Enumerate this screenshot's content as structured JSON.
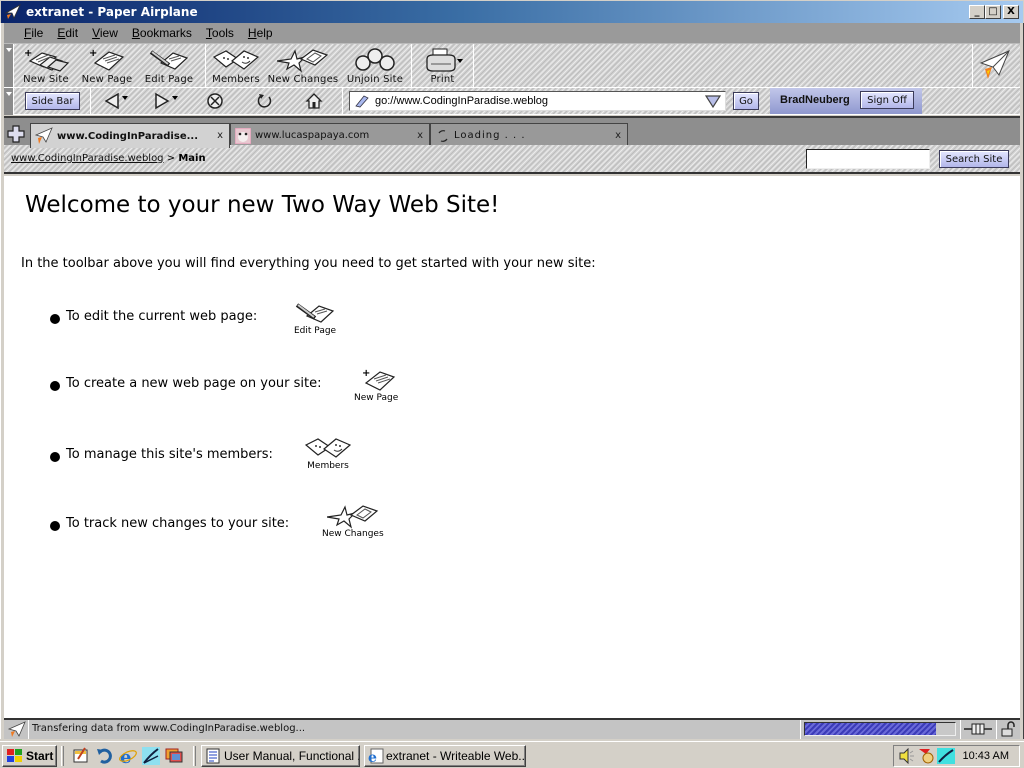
{
  "window": {
    "title": "extranet - Paper Airplane",
    "minimize": "_",
    "maximize": "□",
    "close": "X"
  },
  "menu": {
    "items": [
      {
        "label": "File",
        "accel": "F"
      },
      {
        "label": "Edit",
        "accel": "E"
      },
      {
        "label": "View",
        "accel": "V"
      },
      {
        "label": "Bookmarks",
        "accel": "B"
      },
      {
        "label": "Tools",
        "accel": "T"
      },
      {
        "label": "Help",
        "accel": "H"
      }
    ]
  },
  "toolbar": {
    "buttons": [
      {
        "label": "New Site",
        "icon": "new-site-icon"
      },
      {
        "label": "New Page",
        "icon": "new-page-icon"
      },
      {
        "label": "Edit Page",
        "icon": "edit-page-icon"
      },
      {
        "label": "Members",
        "icon": "members-icon"
      },
      {
        "label": "New Changes",
        "icon": "new-changes-icon"
      },
      {
        "label": "Unjoin Site",
        "icon": "unjoin-site-icon"
      },
      {
        "label": "Print",
        "icon": "printer-icon"
      }
    ]
  },
  "navbar": {
    "sidebar_label": "Side Bar",
    "url": "go://www.CodingInParadise.weblog",
    "go_label": "Go",
    "username": "BradNeuberg",
    "signoff_label": "Sign Off"
  },
  "tabs": [
    {
      "title": "www.CodingInParadise...",
      "close": "x",
      "active": true,
      "icon": "paper-airplane-icon"
    },
    {
      "title": "www.lucaspapaya.com",
      "close": "x",
      "active": false,
      "icon": "site-favicon"
    },
    {
      "title": "Loading . . .",
      "close": "x",
      "active": false,
      "icon": "loading-icon"
    }
  ],
  "breadcrumb": {
    "site_link": "www.CodingInParadise.weblog",
    "separator": ">",
    "current": "Main"
  },
  "search": {
    "value": "",
    "button_label": "Search Site"
  },
  "content": {
    "heading": "Welcome to your new Two Way Web Site!",
    "intro": "In the toolbar above you will find everything you need to get started with your new site:",
    "items": [
      {
        "text": "To edit the current web page:",
        "icon_label": "Edit Page"
      },
      {
        "text": "To create a new web page on your site:",
        "icon_label": "New Page"
      },
      {
        "text": "To manage this site's members:",
        "icon_label": "Members"
      },
      {
        "text": "To track new changes to your site:",
        "icon_label": "New Changes"
      }
    ]
  },
  "statusbar": {
    "text": "Transfering data from www.CodingInParadise.weblog...",
    "progress_percent": 87
  },
  "taskbar": {
    "start_label": "Start",
    "tasks": [
      {
        "label": "User Manual, Functional ..."
      },
      {
        "label": "extranet - Writeable Web..."
      }
    ],
    "clock": "10:43 AM"
  }
}
